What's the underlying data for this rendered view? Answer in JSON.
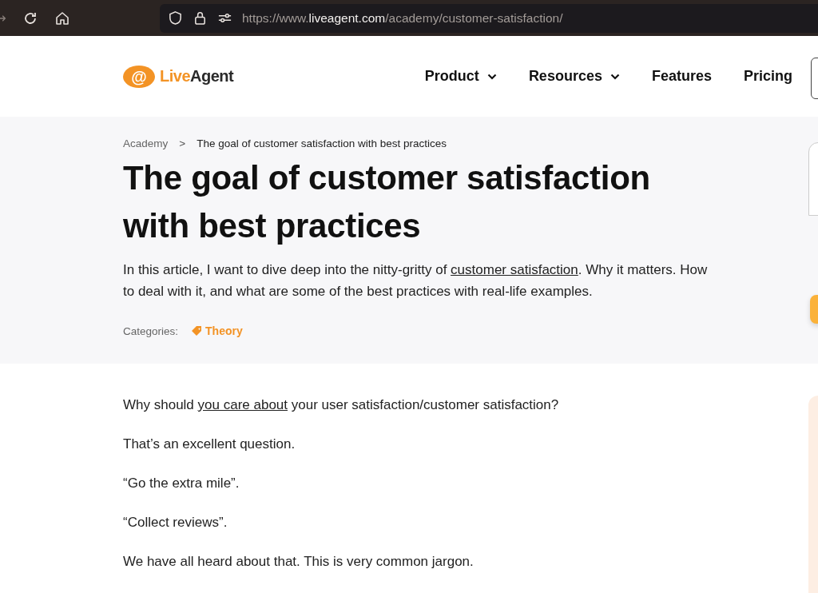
{
  "browser": {
    "url": [
      {
        "text": "https://www.",
        "kind": "dim"
      },
      {
        "text": "liveagent.com",
        "kind": "host"
      },
      {
        "text": "/academy/customer-satisfaction/",
        "kind": "dim"
      }
    ]
  },
  "header": {
    "logo": {
      "mark": "@",
      "parts": [
        "Live",
        "Agent"
      ]
    },
    "nav": [
      {
        "label": "Product",
        "dropdown": true
      },
      {
        "label": "Resources",
        "dropdown": true
      },
      {
        "label": "Features",
        "dropdown": false
      },
      {
        "label": "Pricing",
        "dropdown": false
      }
    ]
  },
  "breadcrumb": {
    "items": [
      "Academy",
      "The goal of customer satisfaction with best practices"
    ],
    "separator": ">"
  },
  "title": "The goal of customer satisfaction with best practices",
  "lead": [
    {
      "text": "In this article, I want to dive deep into the nitty-gritty of "
    },
    {
      "text": "customer satisfaction",
      "link": true
    },
    {
      "text": ". Why it matters. How to deal with it, and what are some of the best practices with real-life examples."
    }
  ],
  "categories": {
    "label": "Categories:",
    "tags": [
      "Theory"
    ]
  },
  "paragraphs": [
    [
      {
        "text": "Why should "
      },
      {
        "text": "you care about",
        "link": true
      },
      {
        "text": " your user satisfaction/customer satisfaction?"
      }
    ],
    [
      {
        "text": "That’s an excellent question."
      }
    ],
    [
      {
        "text": "“Go the extra mile”."
      }
    ],
    [
      {
        "text": "“Collect reviews”."
      }
    ],
    [
      {
        "text": "We have all heard about that. This is very common jargon."
      }
    ]
  ]
}
